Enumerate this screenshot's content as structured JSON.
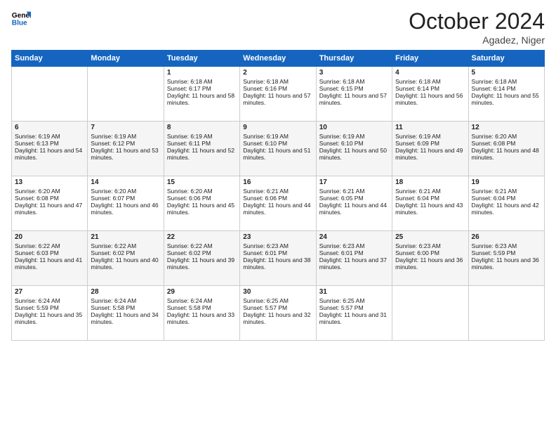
{
  "logo": {
    "line1": "General",
    "line2": "Blue"
  },
  "title": "October 2024",
  "location": "Agadez, Niger",
  "headers": [
    "Sunday",
    "Monday",
    "Tuesday",
    "Wednesday",
    "Thursday",
    "Friday",
    "Saturday"
  ],
  "weeks": [
    [
      {
        "day": "",
        "sunrise": "",
        "sunset": "",
        "daylight": "",
        "empty": true
      },
      {
        "day": "",
        "sunrise": "",
        "sunset": "",
        "daylight": "",
        "empty": true
      },
      {
        "day": "1",
        "sunrise": "Sunrise: 6:18 AM",
        "sunset": "Sunset: 6:17 PM",
        "daylight": "Daylight: 11 hours and 58 minutes."
      },
      {
        "day": "2",
        "sunrise": "Sunrise: 6:18 AM",
        "sunset": "Sunset: 6:16 PM",
        "daylight": "Daylight: 11 hours and 57 minutes."
      },
      {
        "day": "3",
        "sunrise": "Sunrise: 6:18 AM",
        "sunset": "Sunset: 6:15 PM",
        "daylight": "Daylight: 11 hours and 57 minutes."
      },
      {
        "day": "4",
        "sunrise": "Sunrise: 6:18 AM",
        "sunset": "Sunset: 6:14 PM",
        "daylight": "Daylight: 11 hours and 56 minutes."
      },
      {
        "day": "5",
        "sunrise": "Sunrise: 6:18 AM",
        "sunset": "Sunset: 6:14 PM",
        "daylight": "Daylight: 11 hours and 55 minutes."
      }
    ],
    [
      {
        "day": "6",
        "sunrise": "Sunrise: 6:19 AM",
        "sunset": "Sunset: 6:13 PM",
        "daylight": "Daylight: 11 hours and 54 minutes."
      },
      {
        "day": "7",
        "sunrise": "Sunrise: 6:19 AM",
        "sunset": "Sunset: 6:12 PM",
        "daylight": "Daylight: 11 hours and 53 minutes."
      },
      {
        "day": "8",
        "sunrise": "Sunrise: 6:19 AM",
        "sunset": "Sunset: 6:11 PM",
        "daylight": "Daylight: 11 hours and 52 minutes."
      },
      {
        "day": "9",
        "sunrise": "Sunrise: 6:19 AM",
        "sunset": "Sunset: 6:10 PM",
        "daylight": "Daylight: 11 hours and 51 minutes."
      },
      {
        "day": "10",
        "sunrise": "Sunrise: 6:19 AM",
        "sunset": "Sunset: 6:10 PM",
        "daylight": "Daylight: 11 hours and 50 minutes."
      },
      {
        "day": "11",
        "sunrise": "Sunrise: 6:19 AM",
        "sunset": "Sunset: 6:09 PM",
        "daylight": "Daylight: 11 hours and 49 minutes."
      },
      {
        "day": "12",
        "sunrise": "Sunrise: 6:20 AM",
        "sunset": "Sunset: 6:08 PM",
        "daylight": "Daylight: 11 hours and 48 minutes."
      }
    ],
    [
      {
        "day": "13",
        "sunrise": "Sunrise: 6:20 AM",
        "sunset": "Sunset: 6:08 PM",
        "daylight": "Daylight: 11 hours and 47 minutes."
      },
      {
        "day": "14",
        "sunrise": "Sunrise: 6:20 AM",
        "sunset": "Sunset: 6:07 PM",
        "daylight": "Daylight: 11 hours and 46 minutes."
      },
      {
        "day": "15",
        "sunrise": "Sunrise: 6:20 AM",
        "sunset": "Sunset: 6:06 PM",
        "daylight": "Daylight: 11 hours and 45 minutes."
      },
      {
        "day": "16",
        "sunrise": "Sunrise: 6:21 AM",
        "sunset": "Sunset: 6:06 PM",
        "daylight": "Daylight: 11 hours and 44 minutes."
      },
      {
        "day": "17",
        "sunrise": "Sunrise: 6:21 AM",
        "sunset": "Sunset: 6:05 PM",
        "daylight": "Daylight: 11 hours and 44 minutes."
      },
      {
        "day": "18",
        "sunrise": "Sunrise: 6:21 AM",
        "sunset": "Sunset: 6:04 PM",
        "daylight": "Daylight: 11 hours and 43 minutes."
      },
      {
        "day": "19",
        "sunrise": "Sunrise: 6:21 AM",
        "sunset": "Sunset: 6:04 PM",
        "daylight": "Daylight: 11 hours and 42 minutes."
      }
    ],
    [
      {
        "day": "20",
        "sunrise": "Sunrise: 6:22 AM",
        "sunset": "Sunset: 6:03 PM",
        "daylight": "Daylight: 11 hours and 41 minutes."
      },
      {
        "day": "21",
        "sunrise": "Sunrise: 6:22 AM",
        "sunset": "Sunset: 6:02 PM",
        "daylight": "Daylight: 11 hours and 40 minutes."
      },
      {
        "day": "22",
        "sunrise": "Sunrise: 6:22 AM",
        "sunset": "Sunset: 6:02 PM",
        "daylight": "Daylight: 11 hours and 39 minutes."
      },
      {
        "day": "23",
        "sunrise": "Sunrise: 6:23 AM",
        "sunset": "Sunset: 6:01 PM",
        "daylight": "Daylight: 11 hours and 38 minutes."
      },
      {
        "day": "24",
        "sunrise": "Sunrise: 6:23 AM",
        "sunset": "Sunset: 6:01 PM",
        "daylight": "Daylight: 11 hours and 37 minutes."
      },
      {
        "day": "25",
        "sunrise": "Sunrise: 6:23 AM",
        "sunset": "Sunset: 6:00 PM",
        "daylight": "Daylight: 11 hours and 36 minutes."
      },
      {
        "day": "26",
        "sunrise": "Sunrise: 6:23 AM",
        "sunset": "Sunset: 5:59 PM",
        "daylight": "Daylight: 11 hours and 36 minutes."
      }
    ],
    [
      {
        "day": "27",
        "sunrise": "Sunrise: 6:24 AM",
        "sunset": "Sunset: 5:59 PM",
        "daylight": "Daylight: 11 hours and 35 minutes."
      },
      {
        "day": "28",
        "sunrise": "Sunrise: 6:24 AM",
        "sunset": "Sunset: 5:58 PM",
        "daylight": "Daylight: 11 hours and 34 minutes."
      },
      {
        "day": "29",
        "sunrise": "Sunrise: 6:24 AM",
        "sunset": "Sunset: 5:58 PM",
        "daylight": "Daylight: 11 hours and 33 minutes."
      },
      {
        "day": "30",
        "sunrise": "Sunrise: 6:25 AM",
        "sunset": "Sunset: 5:57 PM",
        "daylight": "Daylight: 11 hours and 32 minutes."
      },
      {
        "day": "31",
        "sunrise": "Sunrise: 6:25 AM",
        "sunset": "Sunset: 5:57 PM",
        "daylight": "Daylight: 11 hours and 31 minutes."
      },
      {
        "day": "",
        "sunrise": "",
        "sunset": "",
        "daylight": "",
        "empty": true
      },
      {
        "day": "",
        "sunrise": "",
        "sunset": "",
        "daylight": "",
        "empty": true
      }
    ]
  ]
}
